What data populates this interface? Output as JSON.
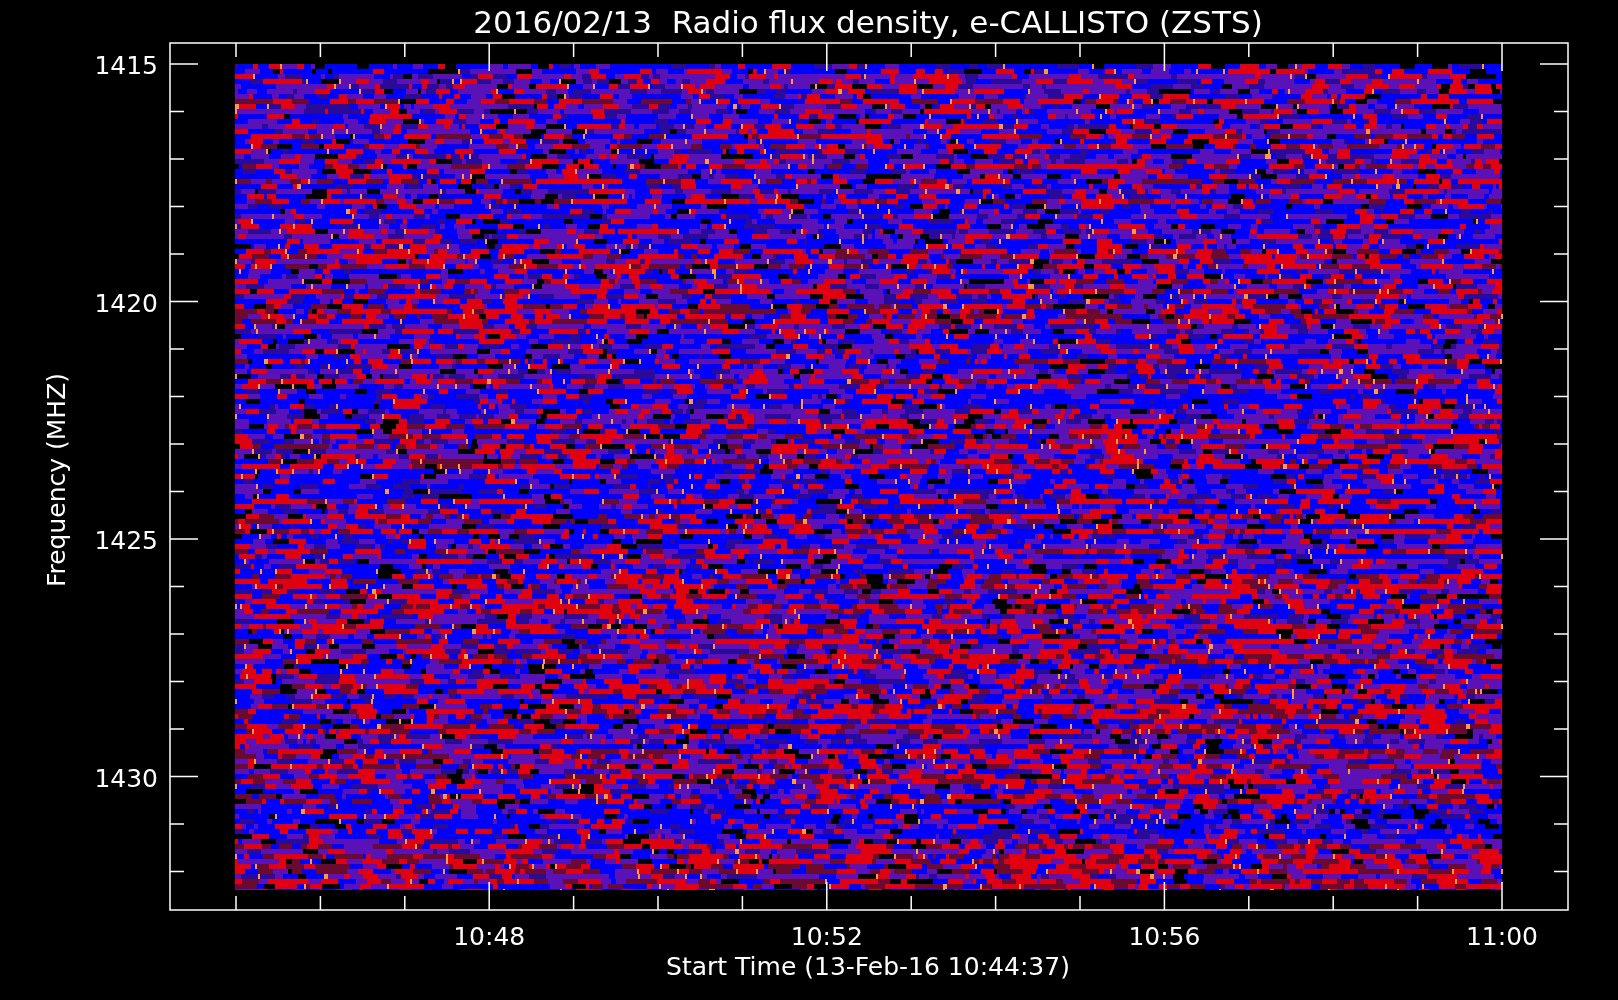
{
  "title": "2016/02/13  Radio flux density, e-CALLISTO (ZSTS)",
  "y_axis": {
    "label": "Frequency (MHZ)",
    "ticks": [
      "1415",
      "1420",
      "1425",
      "1430"
    ]
  },
  "x_axis": {
    "label": "Start Time (13-Feb-16 10:44:37)",
    "ticks": [
      "10:48",
      "10:52",
      "10:56",
      "11:00"
    ]
  }
}
